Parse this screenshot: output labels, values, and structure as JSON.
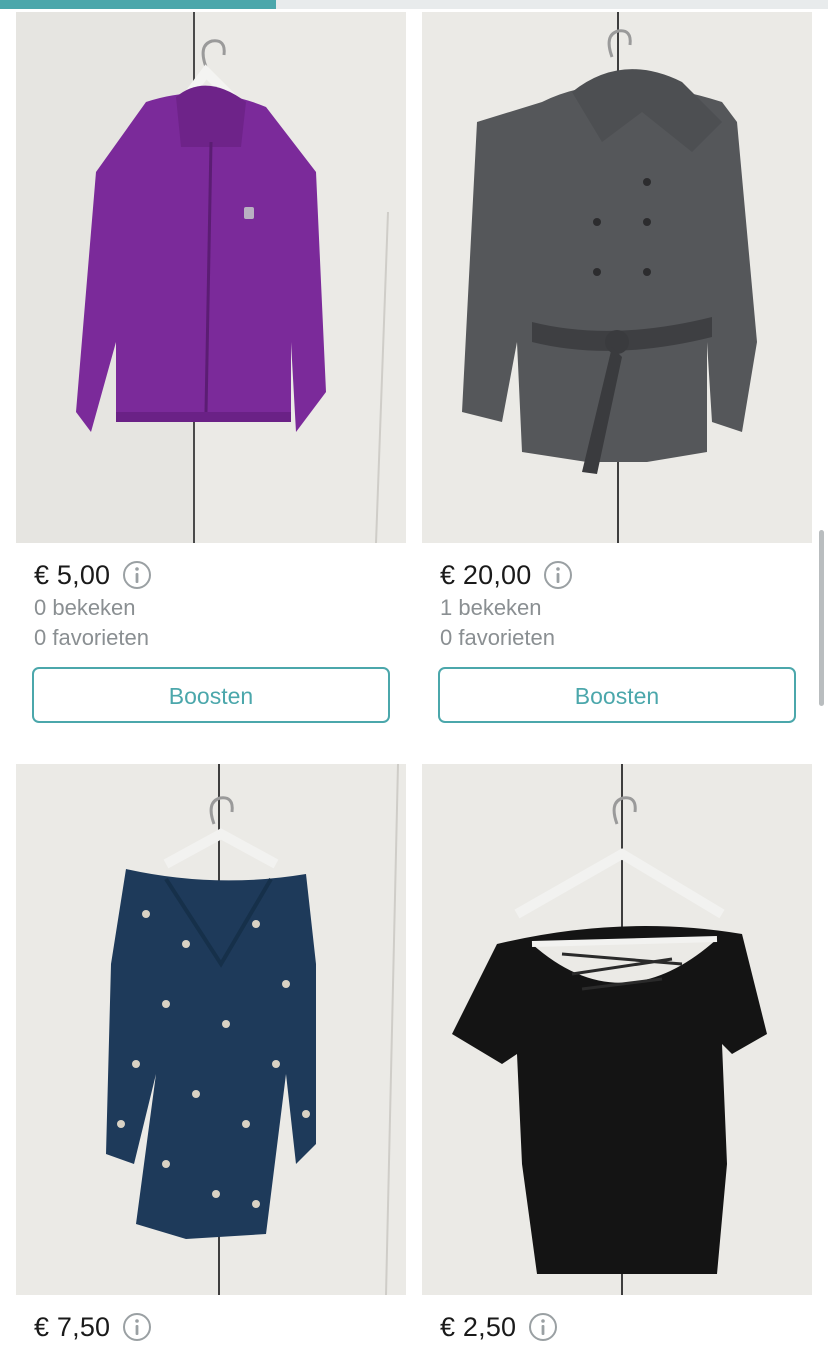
{
  "scroll_progress": 0.333,
  "colors": {
    "accent": "#4ba7ab",
    "price_text": "#1a1a1a",
    "muted_text": "#8a8f92",
    "wardrobe_bg": "#ecebe8"
  },
  "info_icon": "info-circle-icon",
  "listings": [
    {
      "item": "purple-jacket",
      "price": "€ 5,00",
      "views": "0 bekeken",
      "favorites": "0 favorieten",
      "boost_label": "Boosten"
    },
    {
      "item": "grey-wool-coat",
      "price": "€ 20,00",
      "views": "1 bekeken",
      "favorites": "0 favorieten",
      "boost_label": "Boosten"
    },
    {
      "item": "navy-floral-dress",
      "price": "€ 7,50"
    },
    {
      "item": "black-t-shirt",
      "price": "€ 2,50"
    }
  ]
}
